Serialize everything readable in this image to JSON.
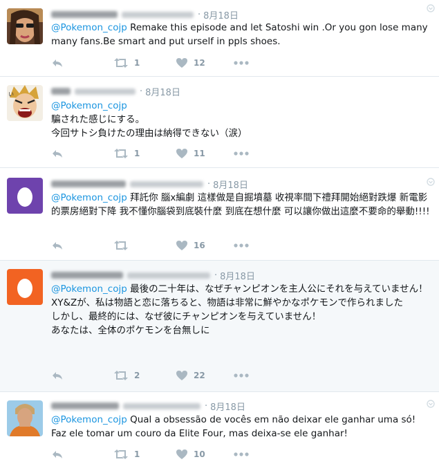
{
  "tweets": [
    {
      "date": "8月18日",
      "mention": "@Pokemon_cojp",
      "text": " Remake this episode and let Satoshi win .Or you gon lose many\nmany fans.Be smart and put urself in ppls shoes.",
      "retweets": "1",
      "likes": "12",
      "avatar": "photo-woman-sunglasses"
    },
    {
      "date": "8月18日",
      "mention": "@Pokemon_cojp",
      "text": "\n騙された感じにする。\n今回サトシ負けたの理由は納得できない（涙）",
      "retweets": "1",
      "likes": "11",
      "avatar": "anime-character"
    },
    {
      "date": "8月18日",
      "mention": "@Pokemon_cojp",
      "text": " 拜託你 腦x編劇 這樣做是自掘墳墓 收視率間下禮拜開始絕對跌爆 新電影的票房絕對下降 我不懂你腦袋到底裝什麼 到底在想什麼 可以讓你做出這麼不要命的舉動!!!!",
      "retweets": "",
      "likes": "16",
      "avatar": "egg-purple"
    },
    {
      "date": "8月18日",
      "mention": "@Pokemon_cojp",
      "text": " 最後の二十年は、なぜチャンピオンを主人公にそれを与えていません！\nXY&Zが、私は物語と恋に落ちると、物語は非常に鮮やかなポケモンで作られました\nしかし、最終的には、なぜ彼にチャンピオンを与えていません！\nあなたは、全体のポケモンを台無しに",
      "retweets": "2",
      "likes": "22",
      "avatar": "egg-orange"
    },
    {
      "date": "8月18日",
      "mention": "@Pokemon_cojp",
      "text": " Qual a obsessão de vocês em não deixar ele ganhar uma só! Faz ele tomar um couro da Elite Four, mas deixa-se ele ganhar!",
      "retweets": "1",
      "likes": "10",
      "avatar": "photo-young-man"
    }
  ],
  "colors": {
    "mention": "#1b95e0",
    "icon": "#aab8c2",
    "meta": "#8899a6",
    "egg_purple": "#6e43ad",
    "egg_orange": "#f26322",
    "highlight_bg": "#f5f8fa"
  }
}
